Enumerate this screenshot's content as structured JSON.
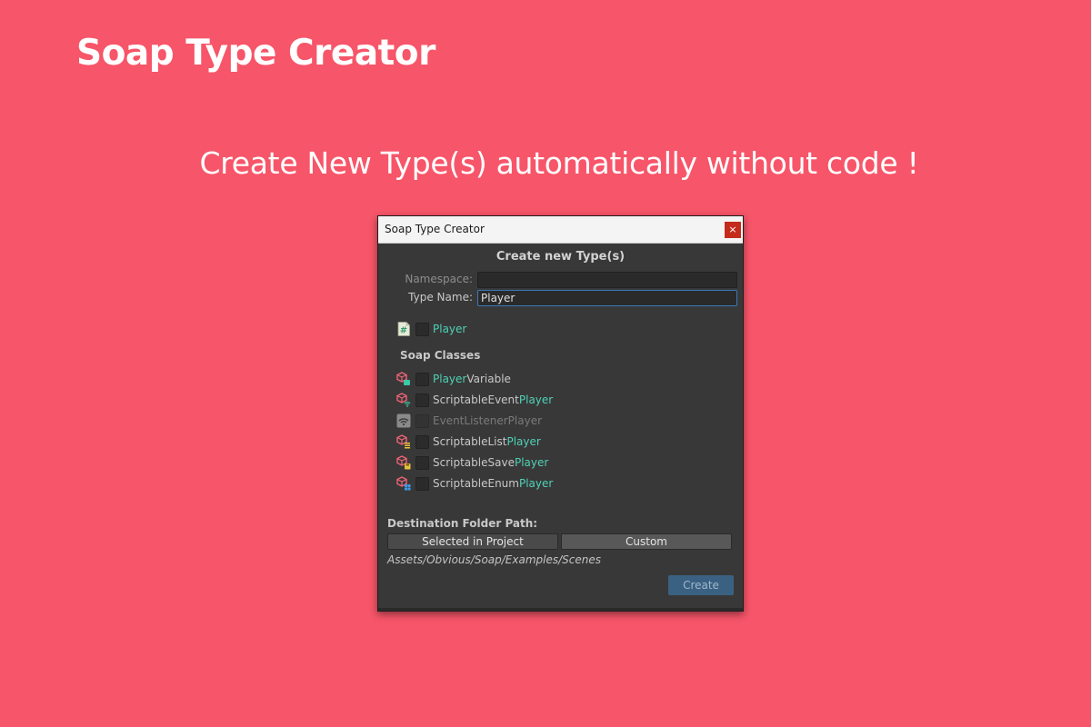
{
  "page": {
    "title": "Soap Type Creator",
    "tagline": "Create New Type(s) automatically without code !"
  },
  "window": {
    "title": "Soap Type Creator",
    "close_symbol": "×",
    "heading": "Create new Type(s)",
    "namespace": {
      "label": "Namespace:",
      "value": "",
      "disabled": true
    },
    "type_name": {
      "label": "Type Name:",
      "value": "Player"
    },
    "class_item": {
      "icon": "csharp-script-icon",
      "name": "Player",
      "checked": false
    },
    "soap_classes_label": "Soap Classes",
    "soap_classes": [
      {
        "icon": "scriptable-variable-icon",
        "prefix": "",
        "name": "Player",
        "suffix": "Variable",
        "checked": false,
        "enabled": true
      },
      {
        "icon": "scriptable-event-icon",
        "prefix": "ScriptableEvent",
        "name": "Player",
        "suffix": "",
        "checked": false,
        "enabled": true
      },
      {
        "icon": "event-listener-icon",
        "prefix": "EventListener",
        "name": "Player",
        "suffix": "",
        "checked": false,
        "enabled": false
      },
      {
        "icon": "scriptable-list-icon",
        "prefix": "ScriptableList",
        "name": "Player",
        "suffix": "",
        "checked": false,
        "enabled": true
      },
      {
        "icon": "scriptable-save-icon",
        "prefix": "ScriptableSave",
        "name": "Player",
        "suffix": "",
        "checked": false,
        "enabled": true
      },
      {
        "icon": "scriptable-enum-icon",
        "prefix": "ScriptableEnum",
        "name": "Player",
        "suffix": "",
        "checked": false,
        "enabled": true
      }
    ],
    "destination": {
      "label": "Destination Folder Path:",
      "selected_button": "Selected in Project",
      "custom_button": "Custom",
      "path": "Assets/Obvious/Soap/Examples/Scenes"
    },
    "create_button": "Create"
  },
  "colors": {
    "background": "#f75569",
    "window": "#383838",
    "accent_teal": "#4fd1b5",
    "create_button": "#3b6182"
  }
}
